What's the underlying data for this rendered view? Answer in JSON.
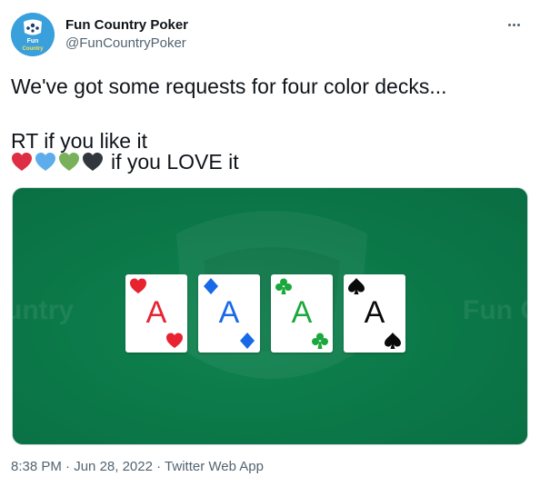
{
  "author": {
    "display_name": "Fun Country Poker",
    "handle": "@FunCountryPoker",
    "avatar_icon": "fun-country-logo",
    "avatar_text_line1": "Fun",
    "avatar_text_line2": "Country",
    "avatar_color": "#3aa0dc"
  },
  "more_icon": "ellipsis-icon",
  "tweet": {
    "text": "We've got some requests for four color decks...\n\nRT if you like it",
    "hearts": [
      {
        "icon": "red-heart-icon",
        "color": "#dd2e44"
      },
      {
        "icon": "blue-heart-icon",
        "color": "#5dadec"
      },
      {
        "icon": "green-heart-icon",
        "color": "#78b159"
      },
      {
        "icon": "black-heart-icon",
        "color": "#31373d"
      }
    ],
    "hearts_label": "if you LOVE it"
  },
  "media": {
    "background_color": "#0b7a4a",
    "watermark_left": "untry",
    "watermark_right": "Fun C",
    "cards": [
      {
        "rank": "A",
        "suit": "hearts",
        "color": "#e8222f"
      },
      {
        "rank": "A",
        "suit": "diamonds",
        "color": "#1769e8"
      },
      {
        "rank": "A",
        "suit": "clubs",
        "color": "#1aa83c"
      },
      {
        "rank": "A",
        "suit": "spades",
        "color": "#0a0a0a"
      }
    ]
  },
  "meta": {
    "time": "8:38 PM",
    "separator": "·",
    "date": "Jun 28, 2022",
    "source": "Twitter Web App"
  }
}
